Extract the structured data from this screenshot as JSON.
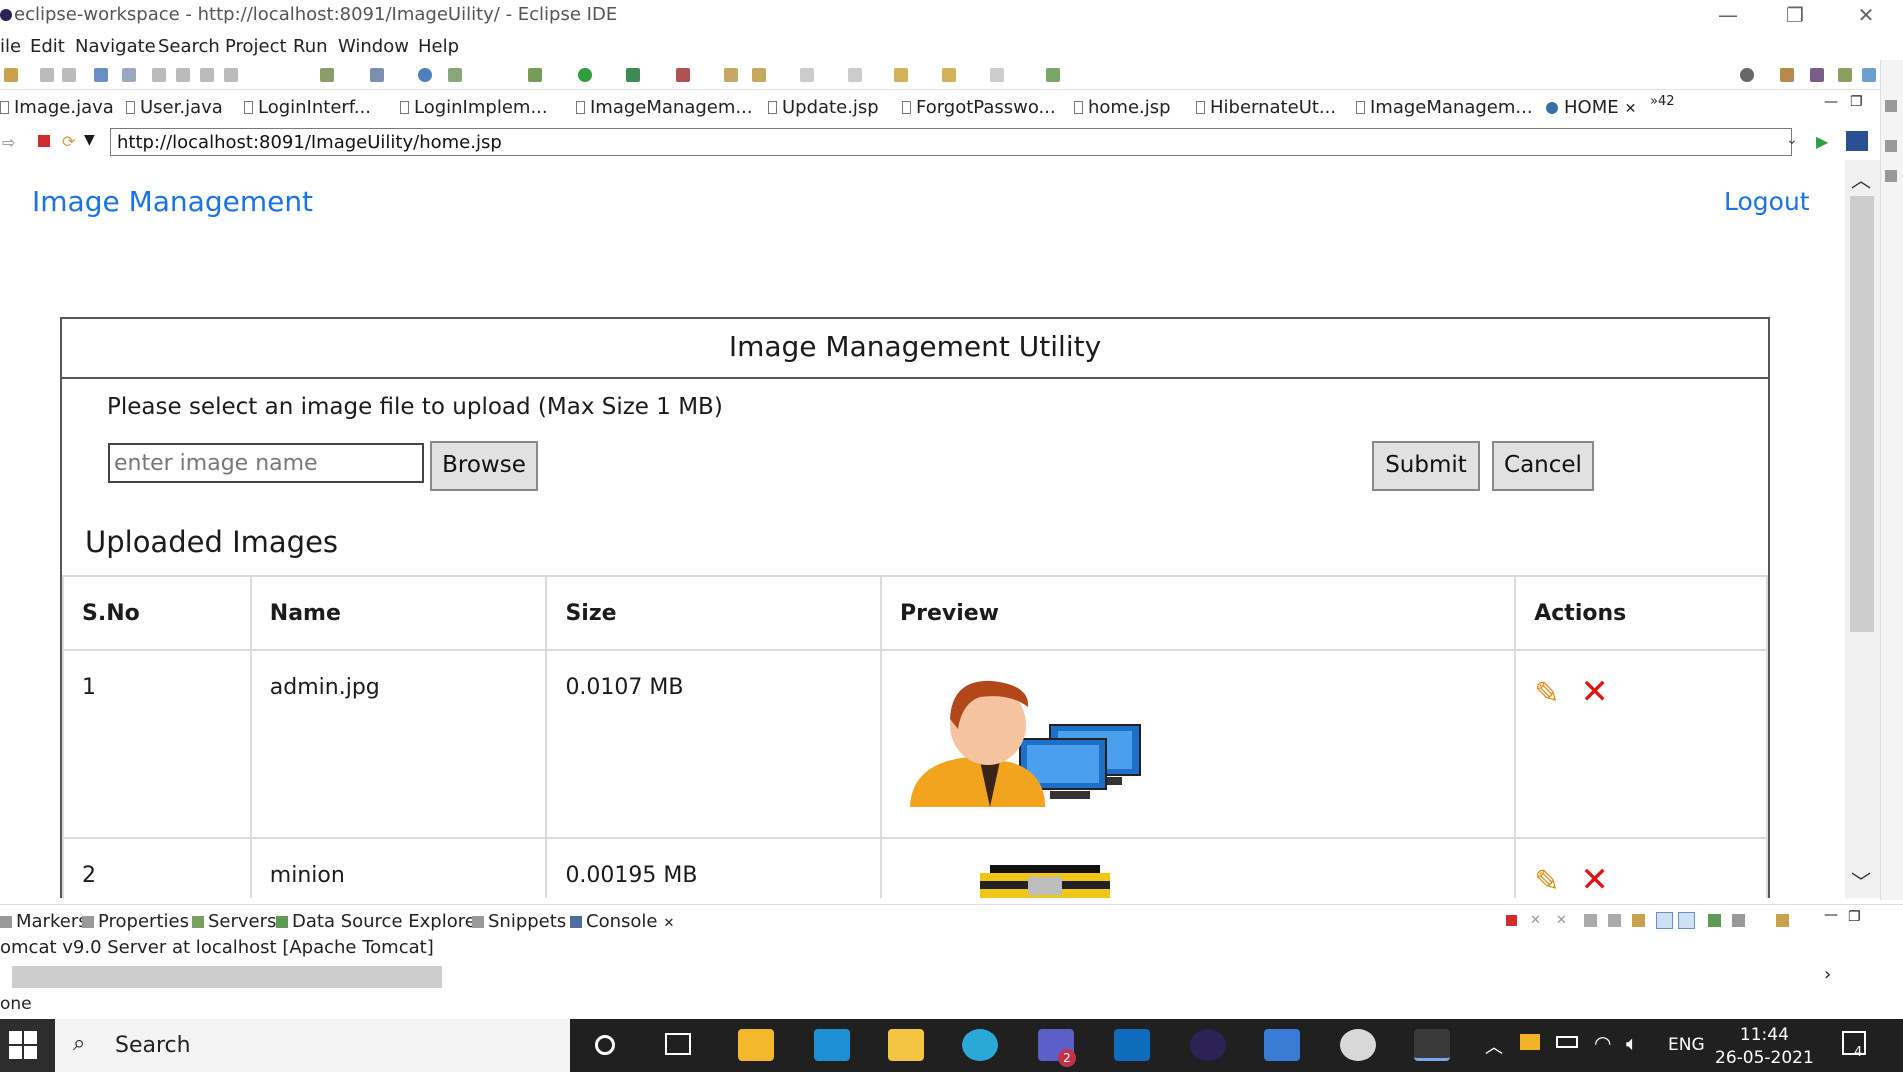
{
  "window": {
    "title": "eclipse-workspace - http://localhost:8091/ImageUility/ - Eclipse IDE",
    "minimize_icon": "—",
    "restore_icon": "❐",
    "close_icon": "✕"
  },
  "menu": [
    "ile",
    "Edit",
    "Navigate",
    "Search",
    "Project",
    "Run",
    "Window",
    "Help"
  ],
  "editor_tabs": [
    "Image.java",
    "User.java",
    "LoginInterf...",
    "LoginImplem...",
    "ImageManagem...",
    "Update.jsp",
    "ForgotPasswo...",
    "home.jsp",
    "HibernateUt...",
    "ImageManagem...",
    "HOME"
  ],
  "overflow_tabs": "»42",
  "browser": {
    "url": "http://localhost:8091/ImageUility/home.jsp"
  },
  "page": {
    "brand": "Image Management",
    "logout": "Logout",
    "panel_title": "Image Management Utility",
    "upload_hint": "Please select an image file to upload (Max Size 1 MB)",
    "name_placeholder": "enter image name",
    "browse_label": "Browse",
    "submit_label": "Submit",
    "cancel_label": "Cancel",
    "uploaded_title": "Uploaded Images",
    "table": {
      "headers": [
        "S.No",
        "Name",
        "Size",
        "Preview",
        "Actions"
      ],
      "rows": [
        {
          "sno": "1",
          "name": "admin.jpg",
          "size": "0.0107 MB"
        },
        {
          "sno": "2",
          "name": "minion",
          "size": "0.00195 MB"
        }
      ]
    }
  },
  "console": {
    "tabs": [
      "Markers",
      "Properties",
      "Servers",
      "Data Source Explorer",
      "Snippets",
      "Console"
    ],
    "line": "omcat v9.0 Server at localhost [Apache Tomcat]",
    "status": "one"
  },
  "taskbar": {
    "search_label": "Search",
    "lang": "ENG",
    "time": "11:44",
    "date": "26-05-2021",
    "notif_count": "4",
    "teams_badge": "2"
  },
  "colors": {
    "link": "#1a73e8",
    "delete": "#e21313",
    "edit": "#e38b14",
    "taskbar": "#202020"
  }
}
